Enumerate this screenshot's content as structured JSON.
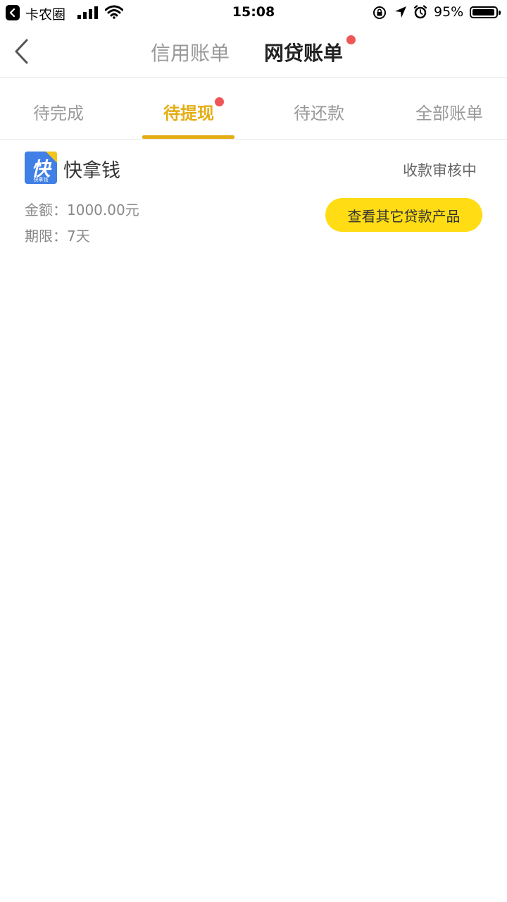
{
  "status_bar": {
    "carrier": "卡农圈",
    "time": "15:08",
    "battery_text": "95%",
    "battery_level": 0.95
  },
  "nav": {
    "tabs": [
      {
        "label": "信用账单",
        "active": false
      },
      {
        "label": "网贷账单",
        "active": true,
        "badge_dot": true
      }
    ]
  },
  "subtabs": [
    {
      "label": "待完成",
      "active": false
    },
    {
      "label": "待提现",
      "active": true,
      "badge_dot": true
    },
    {
      "label": "待还款",
      "active": false
    },
    {
      "label": "全部账单",
      "active": false
    }
  ],
  "loan_item": {
    "logo_glyph": "快",
    "logo_caption": "快拿钱",
    "name": "快拿钱",
    "status": "收款审核中",
    "amount": "金额：1000.00元",
    "term": "期限：7天",
    "action_label": "查看其它贷款产品"
  },
  "colors": {
    "accent": "#e4ad14",
    "button": "#ffdc14",
    "badge": "#f05656",
    "logo_blue": "#3f7fe6"
  },
  "icons": [
    "back-app-icon",
    "signal-icon",
    "wifi-icon",
    "rotation-lock-icon",
    "location-icon",
    "alarm-icon",
    "battery-icon",
    "chevron-left-icon"
  ]
}
